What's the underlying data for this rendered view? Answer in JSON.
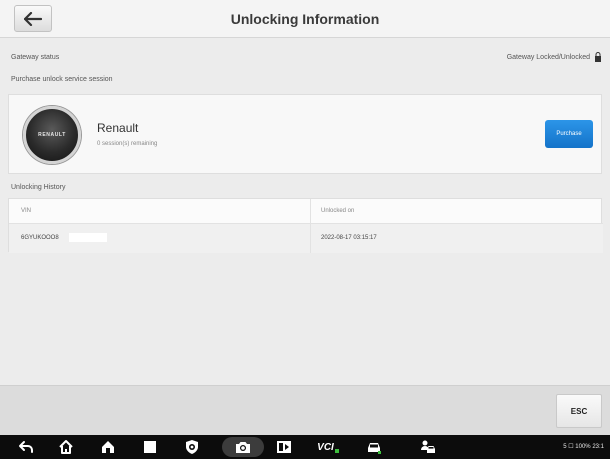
{
  "header": {
    "title": "Unlocking Information",
    "back_icon": "back-arrow-icon"
  },
  "gateway": {
    "label": "Gateway status",
    "value": "Gateway Locked/Unlocked",
    "lock_icon": "lock-icon"
  },
  "purchase_section": {
    "label": "Purchase unlock service session",
    "brand_logo_text": "RENAULT",
    "brand": "Renault",
    "sessions": "0 session(s) remaining",
    "purchase_label": "Purchase"
  },
  "history": {
    "label": "Unlocking History",
    "columns": [
      "VIN",
      "Unlocked on"
    ],
    "rows": [
      {
        "vin": "6GYUKOOO8",
        "unlocked_on": "2022-08-17 03:15:17"
      }
    ]
  },
  "footer": {
    "esc_label": "ESC"
  },
  "navbar": {
    "icons": [
      "back-icon",
      "home-icon",
      "house-icon",
      "square-icon",
      "shield-icon",
      "camera-icon",
      "media-icon",
      "vci-icon",
      "car-icon",
      "user-car-icon"
    ],
    "vci_label": "VCI",
    "status": "5 ☐ 100% 23:1"
  },
  "colors": {
    "accent": "#1a7fd8",
    "background": "#ececec",
    "navbar": "#0c0c0c",
    "vci_dot": "#3fbf3f"
  }
}
